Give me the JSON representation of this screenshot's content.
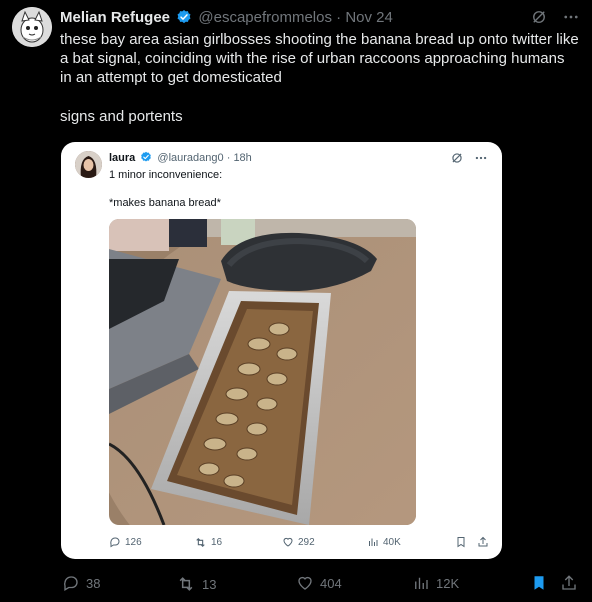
{
  "tweet": {
    "author_name": "Melian Refugee",
    "handle": "@escapefrommelos",
    "separator": "·",
    "date": "Nov 24",
    "text_lines": [
      "these bay area asian girlbosses shooting the banana bread up onto twitter like a bat signal, coinciding with the rise of urban raccoons approaching humans in an attempt to get domesticated",
      "signs and portents"
    ]
  },
  "quote": {
    "author_name": "laura",
    "handle": "@lauradang0",
    "separator": "·",
    "date": "18h",
    "text_lines": [
      "1 minor inconvenience:",
      "*makes banana bread*"
    ],
    "stats": {
      "replies": "126",
      "reposts": "16",
      "likes": "292",
      "views": "40K"
    }
  },
  "stats": {
    "replies": "38",
    "reposts": "13",
    "likes": "404",
    "views": "12K"
  },
  "colors": {
    "background": "#000000",
    "text": "#e7e9ea",
    "muted": "#71767b",
    "accent": "#1d9bf0"
  }
}
